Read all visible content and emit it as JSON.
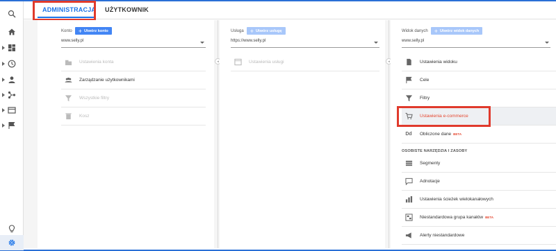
{
  "tabs": {
    "admin": "ADMINISTRACJA",
    "user": "UŻYTKOWNIK"
  },
  "sidebar": {
    "icons": [
      "search-icon",
      "home-icon",
      "dashboard-icon",
      "clock-icon",
      "person-icon",
      "share-icon",
      "display-icon",
      "flag-icon",
      "lightbulb-icon",
      "gear-icon"
    ]
  },
  "account": {
    "label": "Konto",
    "create": "Utwórz konto",
    "selected": "www.selly.pl",
    "items": [
      "Ustawienia konta",
      "Zarządzanie użytkownikami",
      "Wszystkie filtry",
      "Kosz"
    ]
  },
  "property": {
    "label": "Usługa",
    "create": "Utwórz usługę",
    "selected": "https://www.selly.pl",
    "items": [
      "Ustawienia usługi"
    ]
  },
  "view": {
    "label": "Widok danych",
    "create": "Utwórz widok danych",
    "selected": "www.selly.pl",
    "items": [
      "Ustawienia widoku",
      "Cele",
      "Filtry",
      "Ustawienia e-commerce",
      "Obliczone dane"
    ],
    "beta": "BETA",
    "section_title": "OSOBISTE NARZĘDZIA I ZASOBY",
    "tools": [
      "Segmenty",
      "Adnotacje",
      "Ustawienia ścieżek wielokanałowych",
      "Niestandardowa grupa kanałów",
      "Alerty niestandardowe"
    ]
  },
  "colors": {
    "accent": "#1a73e8",
    "highlight_box": "#e03a2c",
    "ecommerce_text": "#e5472f"
  }
}
